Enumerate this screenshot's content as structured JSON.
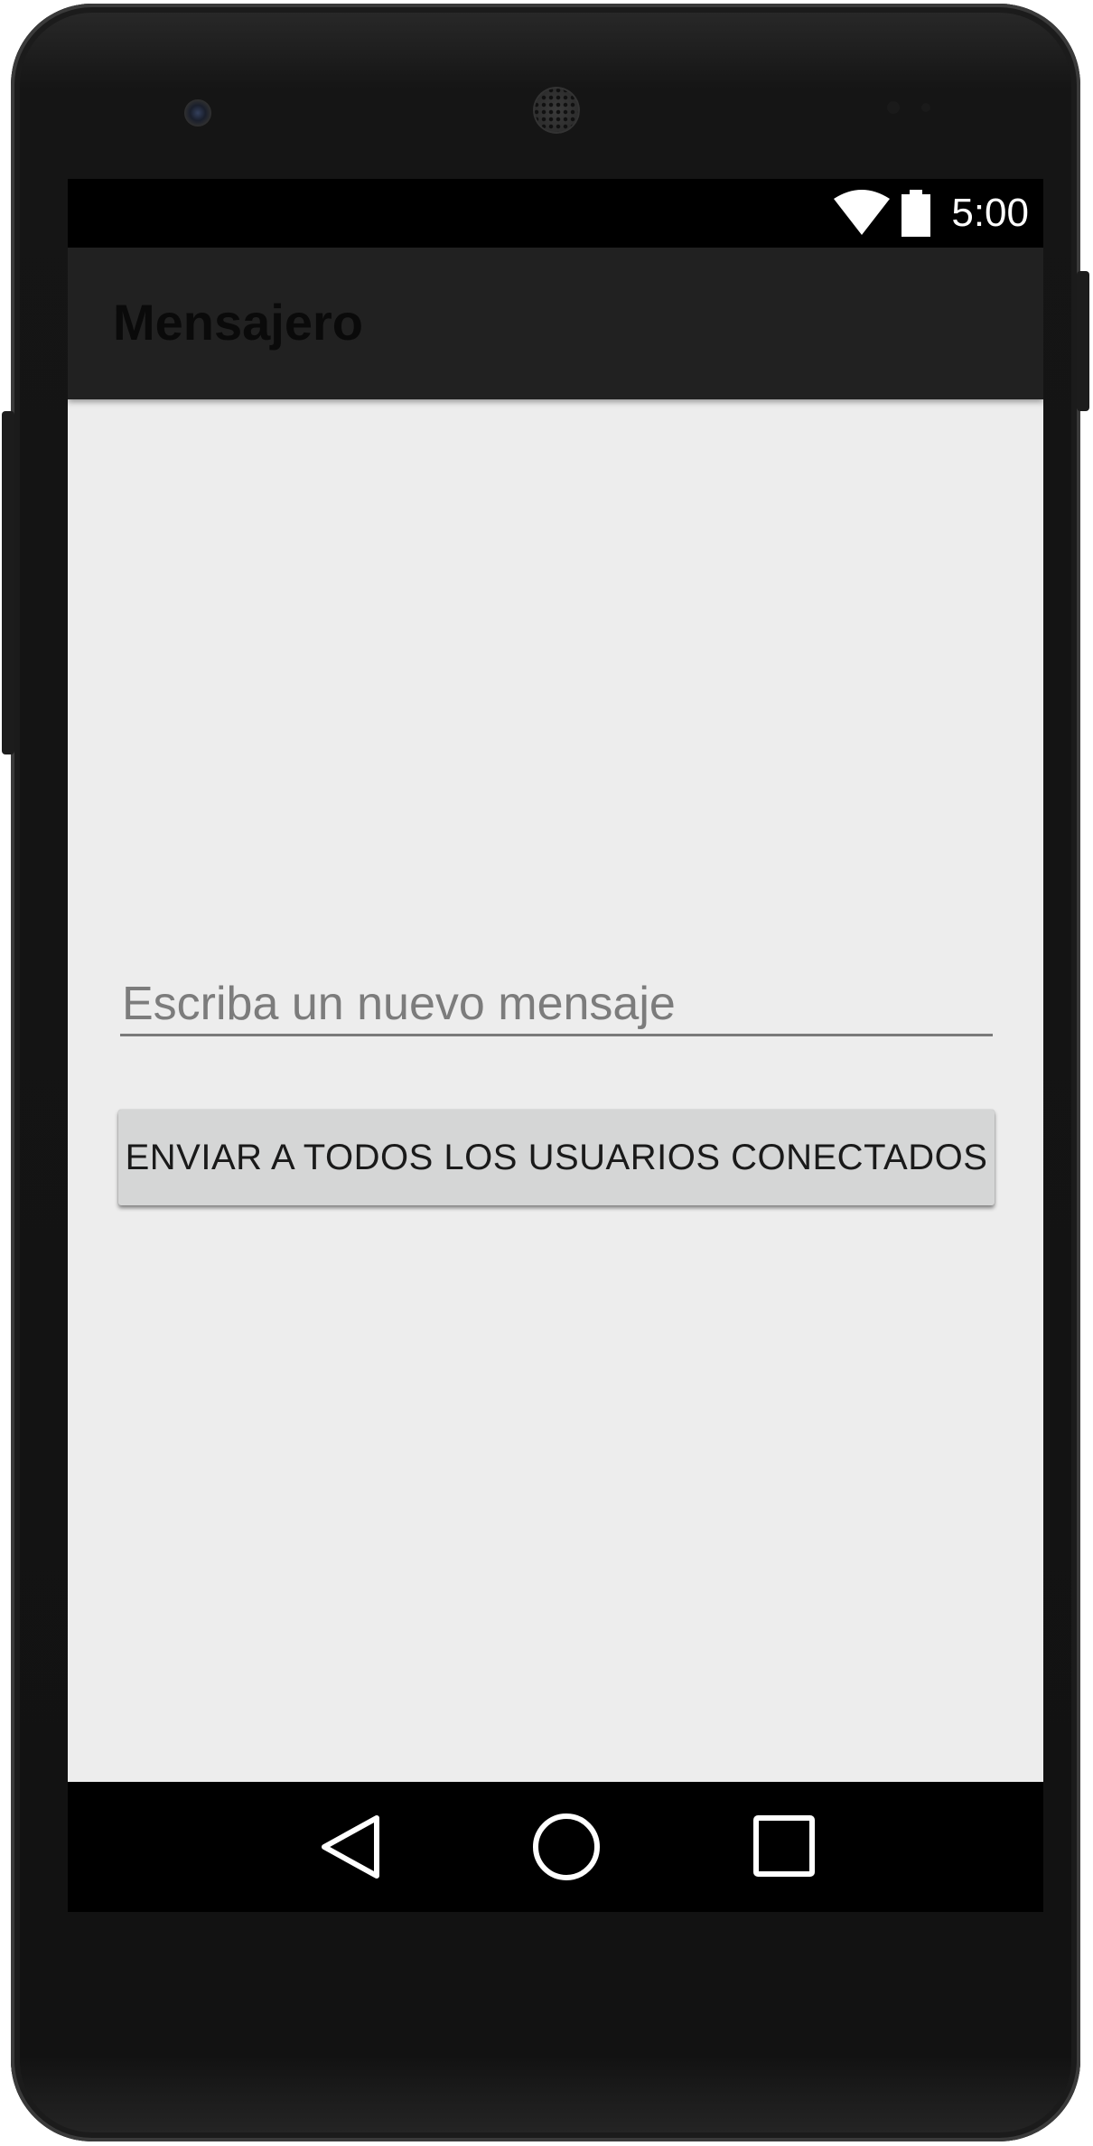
{
  "status_bar": {
    "time": "5:00",
    "icons": [
      "wifi-icon",
      "battery-icon"
    ]
  },
  "app_bar": {
    "title": "Mensajero"
  },
  "form": {
    "message_placeholder": "Escriba un nuevo mensaje",
    "message_value": "",
    "send_button_label": "ENVIAR A TODOS LOS USUARIOS CONECTADOS"
  },
  "nav_bar": {
    "icons": [
      "back-icon",
      "home-icon",
      "recents-icon"
    ]
  },
  "colors": {
    "status_bar": "#000000",
    "action_bar": "#212121",
    "background": "#ededed",
    "button": "#d5d6d6",
    "nav_bar": "#000000"
  }
}
